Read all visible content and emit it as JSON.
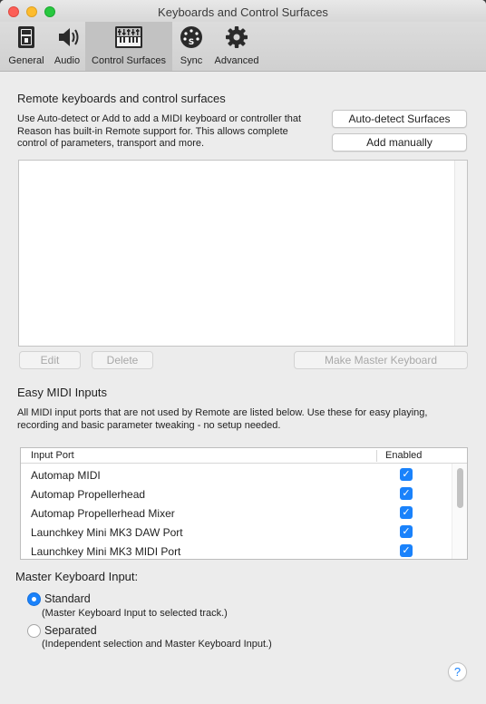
{
  "window": {
    "title": "Keyboards and Control Surfaces"
  },
  "toolbar": {
    "tabs": [
      {
        "label": "General",
        "icon": "general-icon"
      },
      {
        "label": "Audio",
        "icon": "speaker-icon"
      },
      {
        "label": "Control Surfaces",
        "icon": "keyboard-mixer-icon",
        "active": true
      },
      {
        "label": "Sync",
        "icon": "midi-sync-icon"
      },
      {
        "label": "Advanced",
        "icon": "gear-icon"
      }
    ]
  },
  "remote": {
    "heading": "Remote keyboards and control surfaces",
    "description_lines": [
      "Use Auto-detect or Add to add a MIDI keyboard or controller that",
      "Reason has built-in Remote support for. This allows complete",
      "control of parameters, transport and more."
    ],
    "auto_detect_label": "Auto-detect Surfaces",
    "add_manually_label": "Add manually",
    "edit_label": "Edit",
    "delete_label": "Delete",
    "make_master_label": "Make Master Keyboard"
  },
  "easy_midi": {
    "heading": "Easy MIDI Inputs",
    "description_lines": [
      "All MIDI input ports that are not used by Remote are listed below. Use these for easy playing,",
      "recording and basic parameter tweaking - no setup needed."
    ],
    "columns": {
      "port": "Input Port",
      "enabled": "Enabled"
    },
    "rows": [
      {
        "port": "Automap MIDI",
        "enabled": true
      },
      {
        "port": "Automap Propellerhead",
        "enabled": true
      },
      {
        "port": "Automap Propellerhead Mixer",
        "enabled": true
      },
      {
        "port": "Launchkey Mini MK3 DAW Port",
        "enabled": true
      },
      {
        "port": "Launchkey Mini MK3 MIDI Port",
        "enabled": true
      }
    ]
  },
  "master_input": {
    "heading": "Master Keyboard Input:",
    "options": [
      {
        "label": "Standard",
        "desc": "(Master Keyboard Input to selected track.)",
        "selected": true
      },
      {
        "label": "Separated",
        "desc": "(Independent selection and Master Keyboard Input.)",
        "selected": false
      }
    ]
  },
  "help": {
    "label": "?"
  },
  "colors": {
    "accent": "#1a82fb",
    "window_bg": "#ececec",
    "close": "#fc5f57",
    "minimize": "#fdbc2e",
    "maximize": "#28c840"
  }
}
